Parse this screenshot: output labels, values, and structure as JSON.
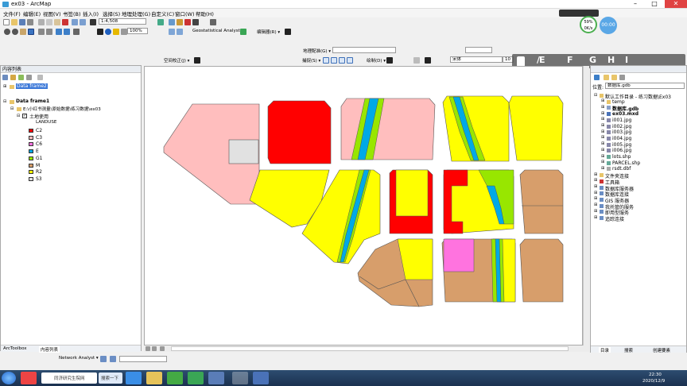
{
  "window": {
    "title": "ex03 - ArcMap"
  },
  "menu": [
    "文件(F)",
    "编辑(E)",
    "视图(V)",
    "书签(B)",
    "插入(I)",
    "选择(S)",
    "地理处理(G)",
    "自定义(C)",
    "窗口(W)",
    "帮助(H)"
  ],
  "toolbar": {
    "scale": "1:4,508",
    "zoom": "100%",
    "geostat": "Geostatistical Analyst ▾",
    "editor": "编辑器(R) ▾",
    "georef": "地理配准(G) ▾",
    "spatial_adjust": "空间校正(J) ▾",
    "snapping": "捕捉(S) ▾",
    "draw": "绘制(D) ▾",
    "font": "宋体",
    "font_size": "10"
  },
  "toc": {
    "title": "内容列表",
    "data_frame2": "Data frame2",
    "data_frame1": "Data frame1",
    "path": "E:\\小红书测量\\原始数据\\练习数据\\ex03",
    "layer": "土地使用",
    "field": "LANDUSE",
    "legend": [
      {
        "label": "C2",
        "color": "#ff0000"
      },
      {
        "label": "C3",
        "color": "#ffbebe"
      },
      {
        "label": "C6",
        "color": "#ff73df"
      },
      {
        "label": "E",
        "color": "#00a9e6"
      },
      {
        "label": "G1",
        "color": "#98e600"
      },
      {
        "label": "M",
        "color": "#d79e6b"
      },
      {
        "label": "R2",
        "color": "#ffff00"
      },
      {
        "label": "S3",
        "color": "#e1e1e1"
      }
    ],
    "tabs": [
      "ArcToolbox",
      "内容列表"
    ]
  },
  "catalog": {
    "location_label": "位置:",
    "location": "数据库.gdb",
    "items": [
      "默认工作目录 - 练习数据\\Ex03",
      "temp",
      "数据库.gdb",
      "ex03.mxd",
      "i001.jpg",
      "i002.jpg",
      "i003.jpg",
      "i004.jpg",
      "i005.jpg",
      "i006.jpg",
      "lots.shp",
      "PARCEL.shp",
      "rsdt.dbf",
      "文件夹连接",
      "工具箱",
      "数据库服务器",
      "数据库连接",
      "GIS 服务器",
      "我托管的服务",
      "即用型服务",
      "追踪连接"
    ],
    "tabs": [
      "目录",
      "搜索",
      "创建要素"
    ]
  },
  "status": {
    "network": "Network Analyst ▾"
  },
  "overlay": [
    "/",
    "E",
    "F",
    "G",
    "H",
    "I"
  ],
  "recorder": {
    "percent": "59%",
    "speed": "0K/s",
    "time": "00:00"
  },
  "taskbar": {
    "browser_tab": "同济研究生院网",
    "search": "搜索一下",
    "time": "22:30",
    "date": "2020/12/9"
  }
}
